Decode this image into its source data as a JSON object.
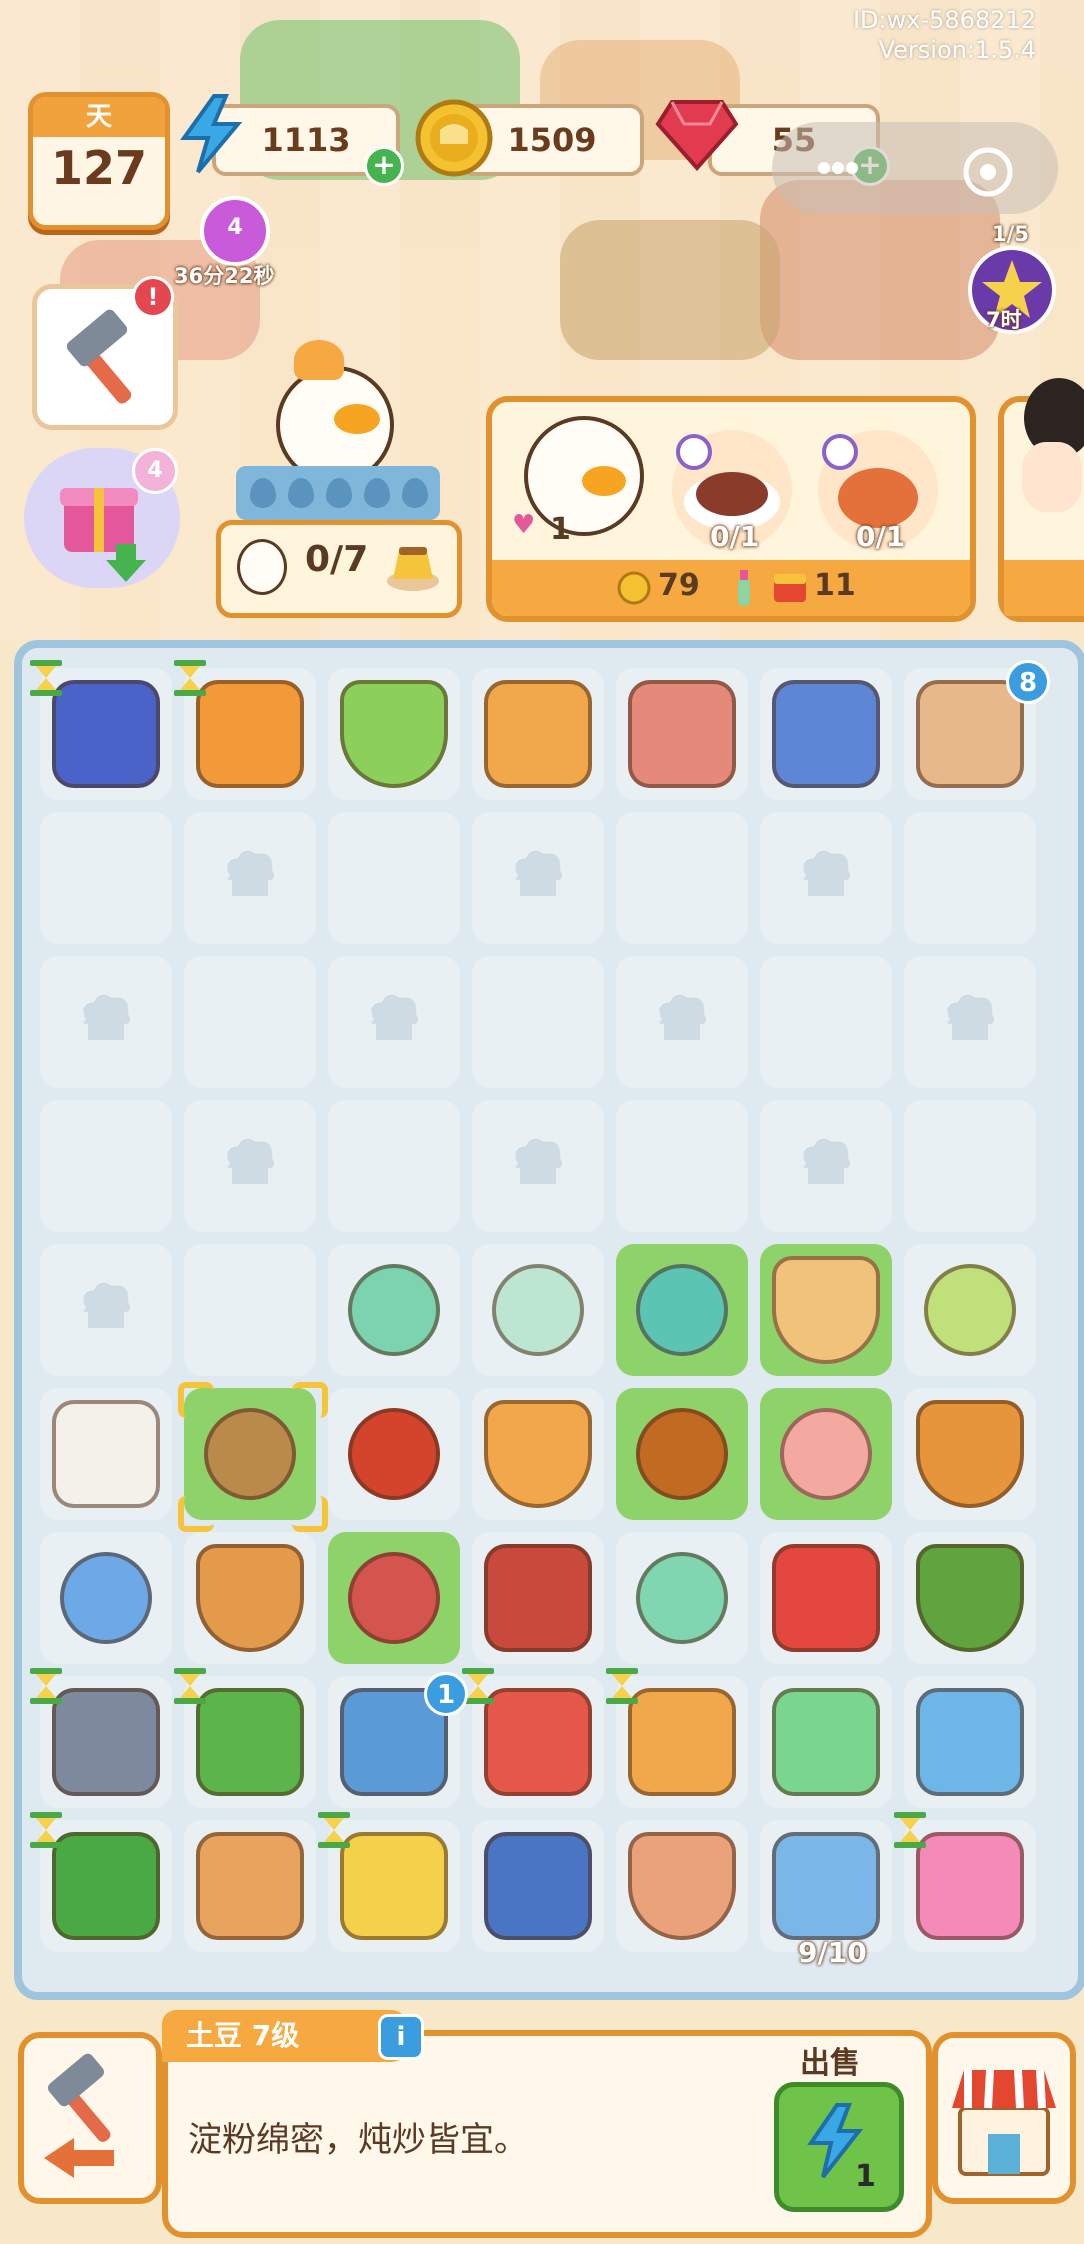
{
  "header": {
    "id_text": "ID:wx-5868212",
    "version_text": "Version:1.5.4"
  },
  "day": {
    "label": "天",
    "value": "127"
  },
  "resources": {
    "energy": "1113",
    "coins": "1509",
    "gems": "55"
  },
  "timer": {
    "badge": "4",
    "text": "36分22秒"
  },
  "hammer": {
    "alert": "!"
  },
  "gift": {
    "count": "4"
  },
  "star": {
    "progress": "1/5",
    "time": "7时"
  },
  "chef": {
    "progress": "0/7"
  },
  "order": {
    "hearts": "1",
    "dish1_progress": "0/1",
    "dish2_progress": "0/1",
    "reward_coins": "79",
    "reward_box": "11"
  },
  "board": {
    "row0": [
      "mailbox-machine",
      "cutting-board-station",
      "veggie-bowl",
      "fruit-crates",
      "meat-showcase",
      "juicer-machine",
      "pizza-cutter"
    ],
    "pizza_cutter_badge": "8",
    "scooter_badge": "1",
    "fridge_capacity": "9/10"
  },
  "bottom": {
    "item_title": "土豆 7级",
    "info": "i",
    "description": "淀粉绵密，炖炒皆宜。",
    "sell_label": "出售",
    "sell_price": "1"
  },
  "colors": {
    "accent": "#e2912f",
    "board_border": "#9ec5dd",
    "highlight": "#8ed36a",
    "energy": "#3aa7e6",
    "coin": "#f4c230",
    "gem": "#e23a4e"
  }
}
